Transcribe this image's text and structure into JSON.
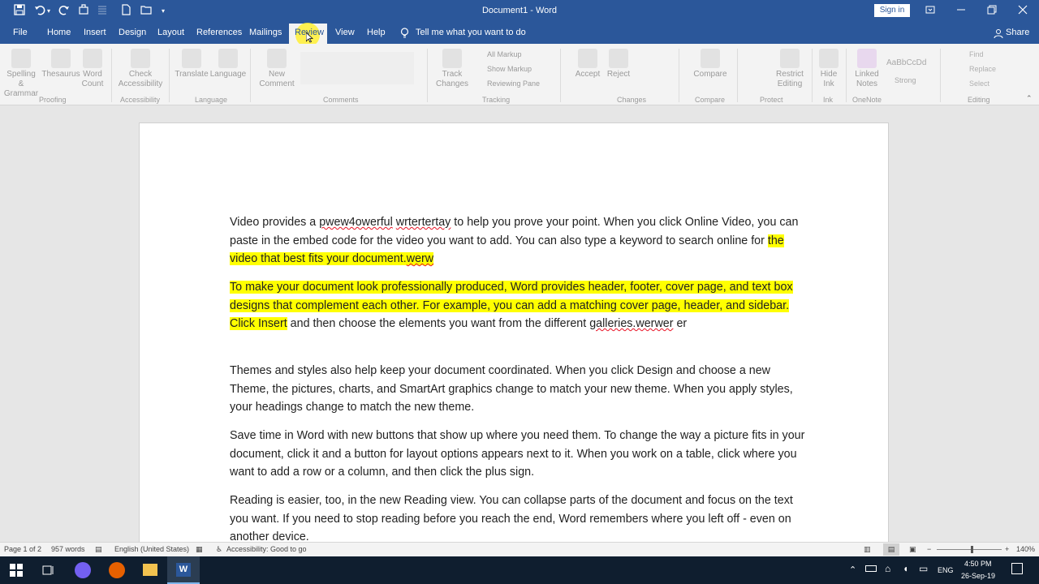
{
  "window": {
    "title": "Document1  -  Word",
    "sign_in": "Sign in",
    "share": "Share"
  },
  "quick_access": {
    "save_icon": "save-icon",
    "undo_icon": "undo-icon",
    "redo_icon": "redo-icon"
  },
  "tabs": [
    "File",
    "Home",
    "Insert",
    "Design",
    "Layout",
    "References",
    "Mailings",
    "Review",
    "View",
    "Help"
  ],
  "active_tab": "Review",
  "tell_me": "Tell me what you want to do",
  "ribbon": {
    "buttons": [
      {
        "label": "Spelling &\nGrammar"
      },
      {
        "label": "Thesaurus"
      },
      {
        "label": "Word\nCount"
      },
      {
        "label": "Check\nAccessibility"
      },
      {
        "label": "Translate"
      },
      {
        "label": "Language"
      },
      {
        "label": "New\nComment"
      },
      {
        "label": "Track\nChanges"
      },
      {
        "label": "Accept"
      },
      {
        "label": "Reject"
      },
      {
        "label": "Compare"
      },
      {
        "label": "Restrict\nEditing"
      },
      {
        "label": "Hide\nInk"
      },
      {
        "label": "Linked\nNotes"
      }
    ],
    "groups": [
      "Proofing",
      "Accessibility",
      "Language",
      "Comments",
      "Tracking",
      "Changes",
      "Compare",
      "Protect",
      "Ink",
      "OneNote"
    ],
    "tracking_options": [
      "All Markup",
      "Show Markup",
      "Reviewing Pane"
    ],
    "styles_samples": [
      "AaBbCcDd",
      "AaBbCcDd",
      "AaBbCcDd"
    ],
    "style_names": [
      "Strong",
      "Editing"
    ],
    "find": "Find",
    "replace": "Replace",
    "select": "Select"
  },
  "document": {
    "p1": {
      "t1": "Video provides a ",
      "t2": "pwew4owerful",
      "t3": " ",
      "t4": "wrtertertay",
      "t5": " to help you prove your point. When you click Online Video, you can paste in the embed code for the video you want to add. You can also type a keyword to search online for ",
      "t6": "the video that best fits your document.",
      "t7": "werw"
    },
    "p2": {
      "t1": "To make your document look professionally produced, Word provides header, footer, cover page, and text box designs that complement each other. For example, you can add a matching cover page, header, and sidebar. Click Insert",
      "t2": " and then choose the elements you want from the different ",
      "t3": "galleries.werwer",
      "t4": " er"
    },
    "p3": "Themes and styles also help keep your document coordinated. When you click Design and choose a new Theme, the pictures, charts, and SmartArt graphics change to match your new theme. When you apply styles, your headings change to match the new theme.",
    "p4": "Save time in Word with new buttons that show up where you need them. To change the way a picture fits in your document, click it and a button for layout options appears next to it. When you work on a table, click where you want to add a row or a column, and then click the plus sign.",
    "p5": "Reading is easier, too, in the new Reading view. You can collapse parts of the document and focus on the text you want. If you need to stop reading before you reach the end, Word remembers where you left off - even on another device."
  },
  "status": {
    "page": "Page 1 of 2",
    "words": "957 words",
    "language": "English (United States)",
    "accessibility": "Accessibility: Good to go",
    "zoom": "140%"
  },
  "taskbar": {
    "lang": "ENG",
    "time": "4:50 PM",
    "date": "26-Sep-19"
  },
  "colors": {
    "word_blue": "#2b579a",
    "highlight": "#ffff00",
    "taskbar": "#0f1e2f"
  }
}
